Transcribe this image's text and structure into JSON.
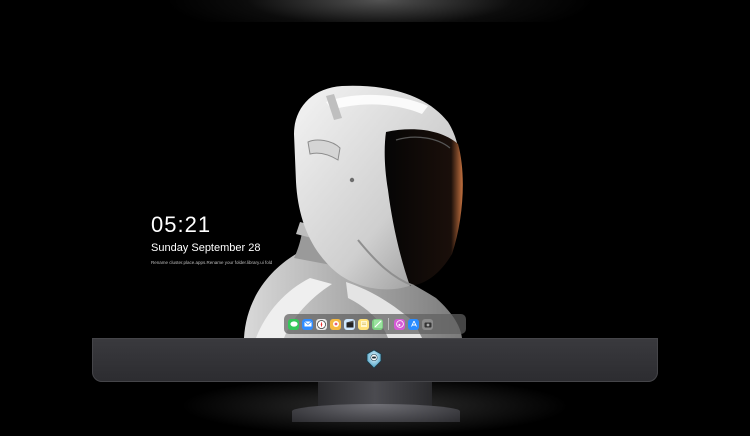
{
  "clock": {
    "time": "05:21",
    "date": "Sunday September  28",
    "caption": "Rename cluster.place.apps.Rename your folder.library.ui fold"
  },
  "dock": {
    "icons": [
      {
        "name": "messages-icon",
        "glyph": "",
        "color": "#34c759"
      },
      {
        "name": "mail-icon",
        "glyph": "",
        "color": "#2f8cff"
      },
      {
        "name": "safari-icon",
        "glyph": "",
        "color": "#e9e9e9"
      },
      {
        "name": "photos-icon",
        "glyph": "",
        "color": "#f5b942"
      },
      {
        "name": "clapperboard-icon",
        "glyph": "",
        "color": "#cfe8ff"
      },
      {
        "name": "notes-icon",
        "glyph": "",
        "color": "#ffe27a"
      },
      {
        "name": "maps-icon",
        "glyph": "",
        "color": "#7fcf84"
      },
      {
        "name": "itunes-icon",
        "glyph": "",
        "color": "#d45bd6"
      },
      {
        "name": "app-store-icon",
        "glyph": "",
        "color": "#2a8cff"
      },
      {
        "name": "camera-icon",
        "glyph": "",
        "color": "#8b8b8b"
      }
    ]
  },
  "accent_colors": {
    "visor_glow": "#c4713f",
    "dock_bg": "#5f5f5f",
    "chin": "#333337"
  }
}
